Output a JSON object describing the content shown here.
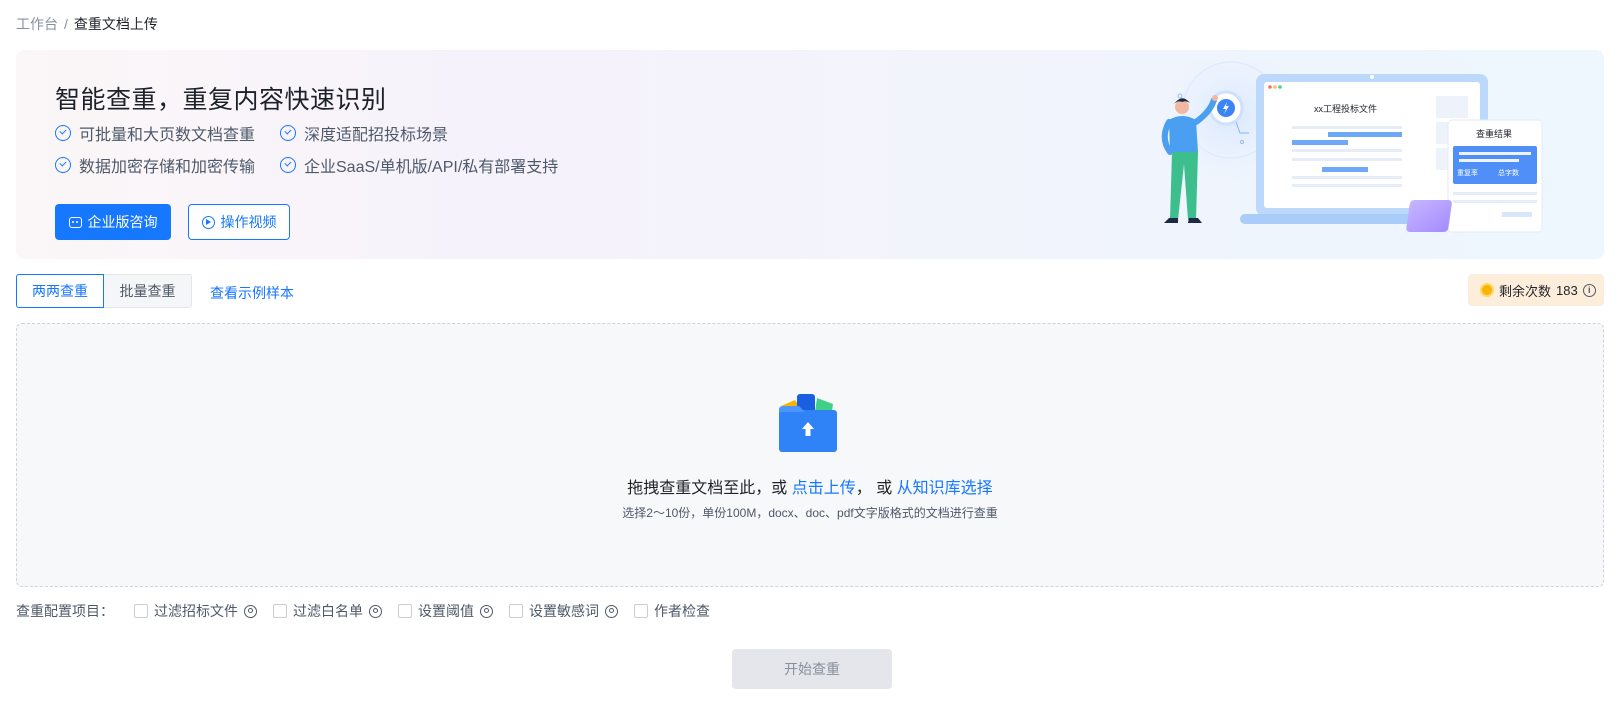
{
  "breadcrumb": {
    "parent": "工作台",
    "separator": "/",
    "current": "查重文档上传"
  },
  "banner": {
    "title": "智能查重，重复内容快速识别",
    "features": [
      "可批量和大页数文档查重",
      "深度适配招投标场景",
      "数据加密存储和加密传输",
      "企业SaaS/单机版/API/私有部署支持"
    ],
    "primary_button": "企业版咨询",
    "video_button": "操作视频",
    "illustration": {
      "doc_title": "xx工程投标文件",
      "result_title": "查重结果",
      "result_rate": "重复率",
      "result_words": "总字数"
    }
  },
  "tabs": [
    {
      "label": "两两查重",
      "active": true
    },
    {
      "label": "批量查重",
      "active": false
    }
  ],
  "sample_link": "查看示例样本",
  "quota": {
    "label": "剩余次数",
    "count": "183"
  },
  "dropzone": {
    "prefix": "拖拽查重文档至此，或 ",
    "upload_link": "点击上传",
    "middle": "， 或 ",
    "kb_link": "从知识库选择",
    "hint": "选择2～10份，单份100M，docx、doc、pdf文字版格式的文档进行查重"
  },
  "config": {
    "label": "查重配置项目：",
    "options": [
      {
        "label": "过滤招标文件",
        "gear": true,
        "checked": false
      },
      {
        "label": "过滤白名单",
        "gear": true,
        "checked": false
      },
      {
        "label": "设置阈值",
        "gear": true,
        "checked": false
      },
      {
        "label": "设置敏感词",
        "gear": true,
        "checked": false
      },
      {
        "label": "作者检查",
        "gear": false,
        "checked": false
      }
    ]
  },
  "start_button": "开始查重",
  "colors": {
    "primary": "#1677ff",
    "quota_bg": "#fdeedc",
    "disabled_bg": "#e5e6eb"
  }
}
